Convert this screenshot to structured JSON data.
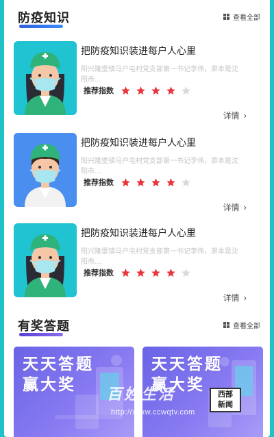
{
  "sections": {
    "knowledge": {
      "title": "防疫知识",
      "view_all": "查看全部"
    },
    "quiz": {
      "title": "有奖答题",
      "view_all": "查看全部"
    }
  },
  "articles": [
    {
      "title": "把防疫知识装进每户人心里",
      "desc": "阳兴隆堡镇马户屯村党支部第一书记李伟，原本是沈阳市....",
      "rating_label": "推荐指数",
      "rating": 4,
      "rating_max": 5,
      "detail": "详情",
      "thumb_bg": "#1fc3d1",
      "doctor": "female-doctor"
    },
    {
      "title": "把防疫知识装进每户人心里",
      "desc": "阳兴隆堡镇马户屯村党支部第一书记李伟，原本是沈阳市....",
      "rating_label": "推荐指数",
      "rating": 4,
      "rating_max": 5,
      "detail": "详情",
      "thumb_bg": "#4a8ef0",
      "doctor": "male-doctor"
    },
    {
      "title": "把防疫知识装进每户人心里",
      "desc": "阳兴隆堡镇马户屯村党支部第一书记李伟，原本是沈阳市....",
      "rating_label": "推荐指数",
      "rating": 4,
      "rating_max": 5,
      "detail": "详情",
      "thumb_bg": "#1fc3d1",
      "doctor": "female-doctor"
    }
  ],
  "banners": [
    {
      "line1": "天天答题",
      "line2": "赢大奖"
    },
    {
      "line1": "天天答题",
      "line2": "赢大奖"
    }
  ],
  "watermark": {
    "name": "百姓生活",
    "url": "http://xbxw.ccwqtv.com",
    "badge_line1": "西部",
    "badge_line2": "新闻"
  },
  "colors": {
    "page_bg": "#1fc2c6",
    "star_on": "#e8363c",
    "star_off": "#d9d9d9",
    "accent_blue": "#2f5fd8",
    "accent_purple": "#6a4fe0"
  }
}
